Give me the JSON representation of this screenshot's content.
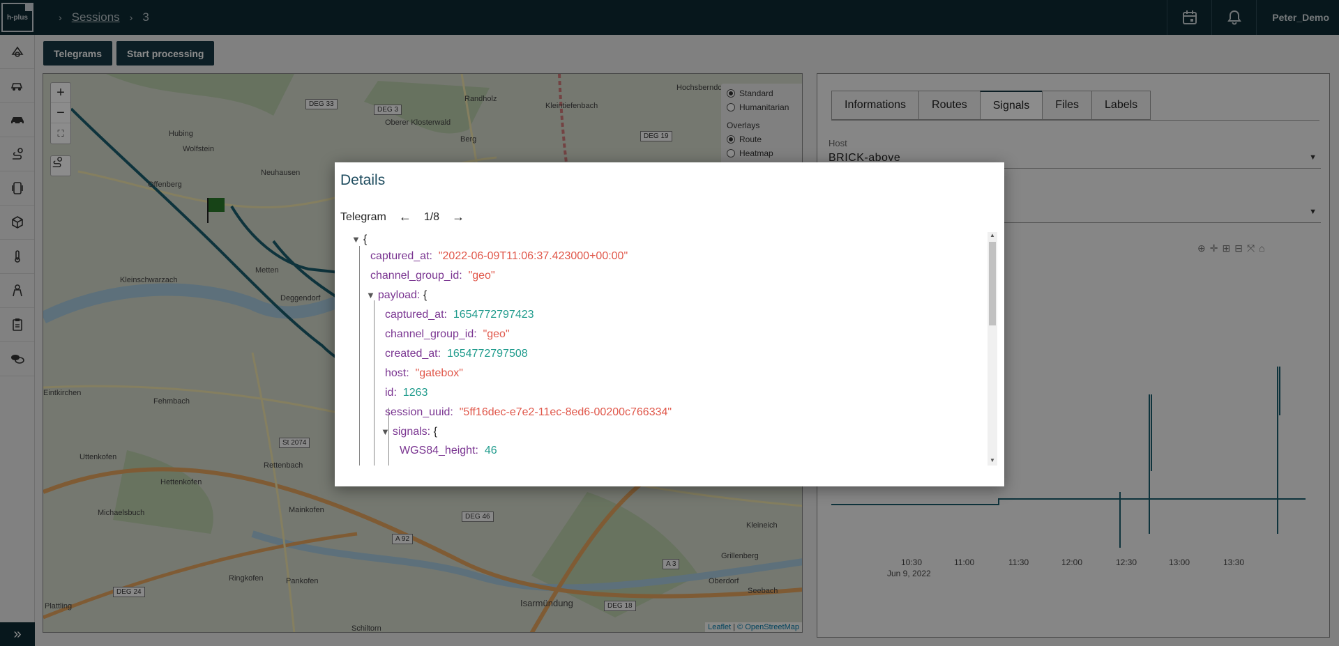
{
  "topbar": {
    "logo_text": "h-plus",
    "breadcrumbs": [
      "Sessions",
      "3"
    ],
    "user": "Peter_Demo"
  },
  "icons": {
    "calendar": "calendar-icon",
    "bell": "bell-icon",
    "expand": "double-chevron-right-icon"
  },
  "toolbar": {
    "telegrams_label": "Telegrams",
    "start_processing_label": "Start processing"
  },
  "map": {
    "layers": {
      "base": [
        {
          "label": "Standard",
          "selected": true
        },
        {
          "label": "Humanitarian",
          "selected": false
        }
      ],
      "overlays_title": "Overlays",
      "overlays": [
        {
          "label": "Route",
          "selected": true
        },
        {
          "label": "Heatmap",
          "selected": false
        }
      ]
    },
    "places": [
      "Hubing",
      "Wolfstein",
      "Offenberg",
      "Neuhausen",
      "Randholz",
      "Oberer Klosterwald",
      "Berg",
      "Kleintiefenbach",
      "Hochsberndorf",
      "Kleinschwarzach",
      "Metten",
      "Deggendorf",
      "Fehmbach",
      "Eintkirchen",
      "Uttenkofen",
      "Rettenbach",
      "Hettenkofen",
      "Michaelsbuch",
      "Mainkofen",
      "Plattling",
      "Ringkofen",
      "Pankofen",
      "Isarmündung",
      "Kleineich",
      "Grillenberg",
      "Oberdorf",
      "Seebach",
      "Schiltorn"
    ],
    "roads": [
      "DEG 33",
      "DEG 3",
      "DEG 19",
      "St 2074",
      "DEG 46",
      "A 92",
      "A 3",
      "DEG 24",
      "DEG 18"
    ],
    "attribution_leaflet": "Leaflet",
    "attribution_osm": "© OpenStreetMap"
  },
  "panel": {
    "tabs": [
      "Informations",
      "Routes",
      "Signals",
      "Files",
      "Labels"
    ],
    "active_tab": "Signals",
    "host_label": "Host",
    "host_value": "BRICK-above",
    "chart": {
      "x_ticks": [
        "10:30",
        "11:00",
        "11:30",
        "12:00",
        "12:30",
        "13:00",
        "13:30"
      ],
      "x_subtitle": "Jun 9, 2022"
    }
  },
  "modal": {
    "title": "Details",
    "telegram_label": "Telegram",
    "position": "1/8",
    "json": {
      "captured_at": "\"2022-06-09T11:06:37.423000+00:00\"",
      "channel_group_id": "\"geo\"",
      "payload": {
        "captured_at": "1654772797423",
        "channel_group_id": "\"geo\"",
        "created_at": "1654772797508",
        "host": "\"gatebox\"",
        "id": "1263",
        "session_uuid": "\"5ff16dec-e7e2-11ec-8ed6-00200c766334\"",
        "signals": {
          "WGS84_height": "46"
        }
      }
    }
  },
  "colors": {
    "topbar": "#0e2a33",
    "button": "#163844",
    "json_key": "#7a3591",
    "json_string": "#e0574a",
    "json_number": "#1f9b8c",
    "route": "#1b5d6e"
  }
}
